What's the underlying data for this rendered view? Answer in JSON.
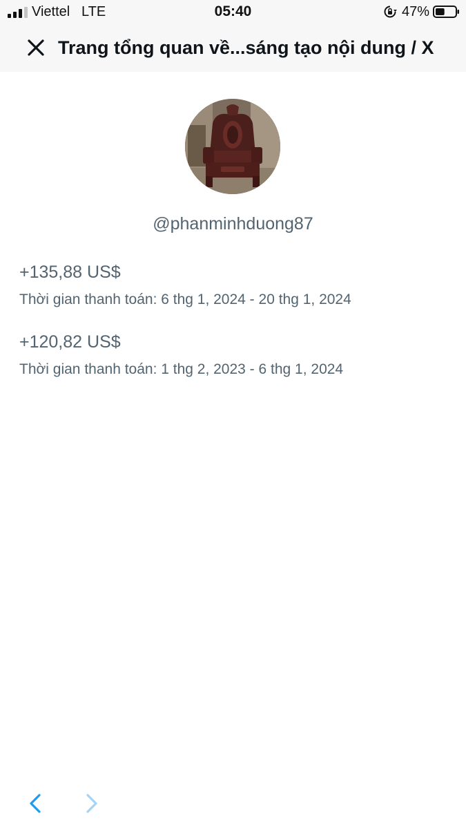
{
  "status_bar": {
    "carrier": "Viettel",
    "network": "LTE",
    "time": "05:40",
    "battery_percent": "47%",
    "signal_bars": 3,
    "battery_level": 0.47
  },
  "header": {
    "close_icon": "close-icon",
    "title": "Trang tổng quan về...sáng tạo nội dung / X"
  },
  "profile": {
    "handle": "@phanminhduong87"
  },
  "payouts": [
    {
      "amount": "+135,88 US$",
      "period": "Thời gian thanh toán: 6 thg 1, 2024 - 20 thg 1, 2024"
    },
    {
      "amount": "+120,82 US$",
      "period": "Thời gian thanh toán: 1 thg 2, 2023 - 6 thg 1, 2024"
    }
  ],
  "nav": {
    "back_icon": "chevron-left-icon",
    "forward_icon": "chevron-right-icon"
  },
  "colors": {
    "accent": "#1d9bf0",
    "accent_disabled": "#a5d3f5",
    "secondary_text": "#536471",
    "title_text": "#0f1419"
  }
}
